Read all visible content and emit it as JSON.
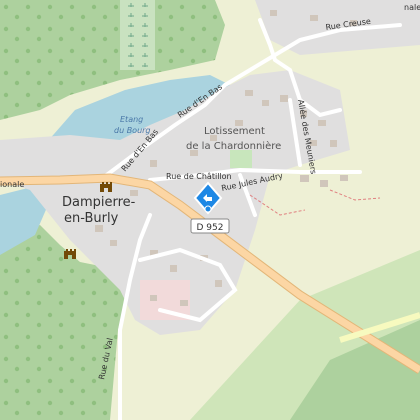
{
  "map": {
    "place_names": {
      "town_line1": "Dampierre-",
      "town_line2": "en-Burly",
      "lotissement_line1": "Lotissement",
      "lotissement_line2": "de la Chardonnière"
    },
    "water_names": {
      "etang_line1": "Etang",
      "etang_line2": "du Bourg"
    },
    "roads": {
      "rue_en_bas_upper": "Rue d'En Bas",
      "rue_en_bas_lower": "Rue d'En Bas",
      "rue_creuse": "Rue Creuse",
      "rue_chatillon": "Rue de Châtillon",
      "rue_jules_audry": "Rue Jules Audry",
      "allee_meuniers": "Allée des Meuniers",
      "rue_du_val": "Rue du Val",
      "nationale_fragment": "ionale",
      "nale_fragment": "nale"
    },
    "route_shield": "D 952",
    "colors": {
      "forest": "#add19e",
      "water": "#aad3df",
      "residential": "#e0dfdf",
      "farmland": "#eef0d5",
      "major_road": "#fcd6a4",
      "marker": "#1e88e5"
    },
    "icons": [
      "castle-icon",
      "castle-icon",
      "map-marker-icon"
    ]
  }
}
